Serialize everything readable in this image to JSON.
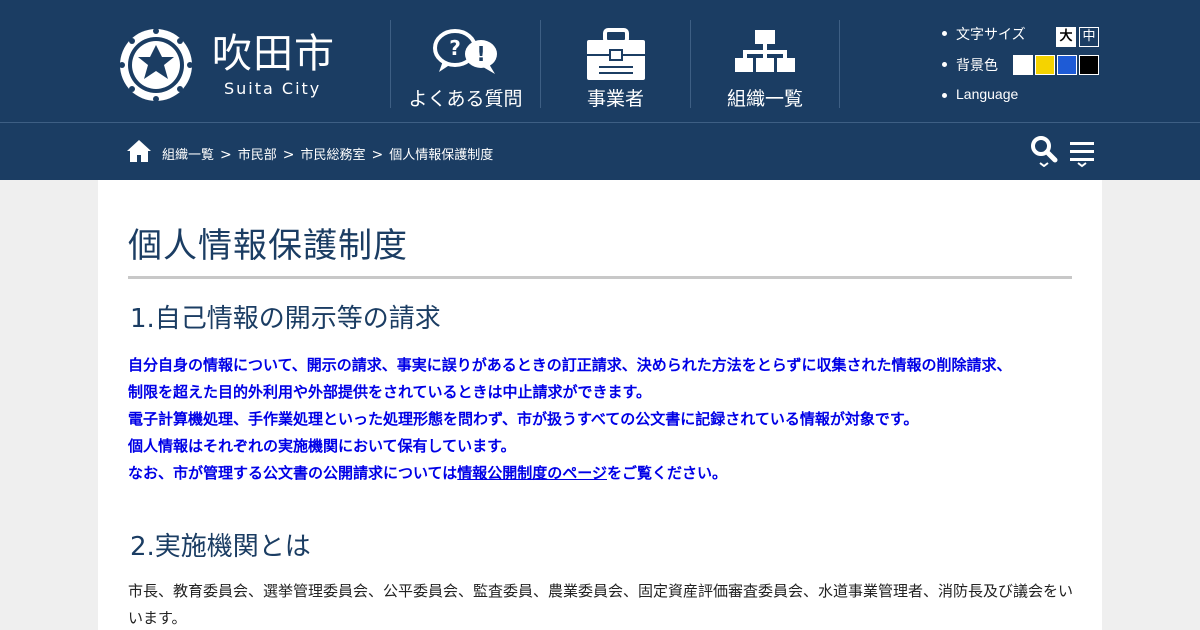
{
  "colors": {
    "header_bg": "#1b3d63",
    "link_blue": "#0000e6",
    "title_color": "#1b3d63",
    "rule": "#c8c8c8"
  },
  "site": {
    "name": "吹田市",
    "name_en": "Suita City"
  },
  "nav": [
    {
      "label": "よくある質問",
      "icon": "faq-bubbles-icon"
    },
    {
      "label": "事業者",
      "icon": "briefcase-icon"
    },
    {
      "label": "組織一覧",
      "icon": "org-chart-icon"
    }
  ],
  "tools": {
    "font_size": {
      "label": "文字サイズ",
      "large": "大",
      "medium": "中"
    },
    "background": {
      "label": "背景色",
      "swatches": [
        "#ffffff",
        "#f5d300",
        "#1e5bd6",
        "#000000"
      ]
    },
    "language": "Language"
  },
  "breadcrumb": [
    "組織一覧",
    "市民部",
    "市民総務室",
    "個人情報保護制度"
  ],
  "page": {
    "title": "個人情報保護制度",
    "sections": [
      {
        "heading": "1.自己情報の開示等の請求",
        "lines": [
          "自分自身の情報について、開示の請求、事実に誤りがあるときの訂正請求、決められた方法をとらずに収集された情報の削除請求、",
          "制限を超えた目的外利用や外部提供をされているときは中止請求ができます。",
          "電子計算機処理、手作業処理といった処理形態を問わず、市が扱うすべての公文書に記録されている情報が対象です。",
          "個人情報はそれぞれの実施機関において保有しています。"
        ],
        "last_line_pre": "なお、市が管理する公文書の公開請求については",
        "last_line_link": "情報公開制度のページ",
        "last_line_post": "をご覧ください。"
      },
      {
        "heading": "2.実施機関とは",
        "text": "市長、教育委員会、選挙管理委員会、公平委員会、監査委員、農業委員会、固定資産評価審査委員会、水道事業管理者、消防長及び議会をいいます。"
      }
    ]
  }
}
